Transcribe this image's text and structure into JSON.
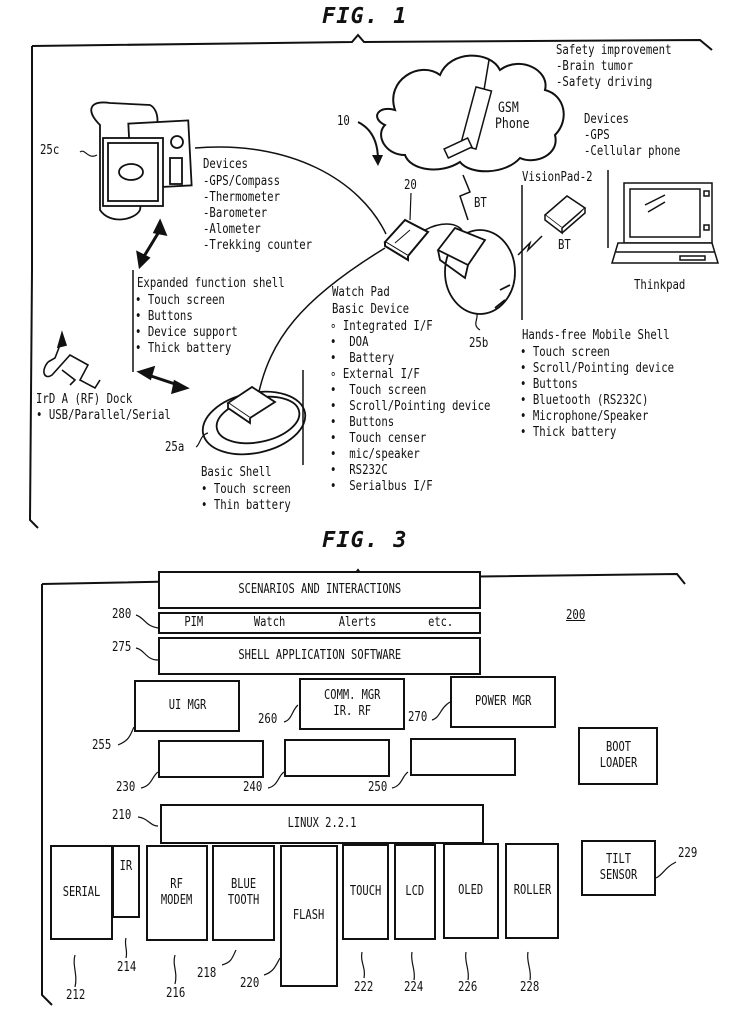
{
  "fig1": {
    "title": "FIG. 1",
    "refs": {
      "r10": "10",
      "r20": "20",
      "r25a": "25a",
      "r25b": "25b",
      "r25c": "25c"
    },
    "cloud": {
      "line1": "GSM",
      "line2": "Phone"
    },
    "safety": {
      "title": "Safety improvement",
      "items": [
        "-Brain tumor",
        "-Safety driving"
      ]
    },
    "devices_right": {
      "title": "Devices",
      "items": [
        "-GPS",
        "-Cellular phone"
      ]
    },
    "visionpad": "VisionPad-2",
    "bt1": "BT",
    "bt2": "BT",
    "thinkpad": "Thinkpad",
    "devices_left": {
      "title": "Devices",
      "items": [
        "-GPS/Compass",
        "-Thermometer",
        "-Barometer",
        "-Alometer",
        "-Trekking counter"
      ]
    },
    "expanded_shell": {
      "title": "Expanded function shell",
      "items": [
        "• Touch screen",
        "• Buttons",
        "• Device support",
        "• Thick battery"
      ]
    },
    "dock": {
      "title": "IrD A (RF) Dock",
      "items": [
        "• USB/Parallel/Serial"
      ]
    },
    "basic_shell": {
      "title": "Basic Shell",
      "items": [
        "• Touch screen",
        "• Thin battery"
      ]
    },
    "watch_pad": {
      "title1": "Watch Pad",
      "title2": "Basic Device",
      "items": [
        "∘ Integrated I/F",
        "•  DOA",
        "•  Battery",
        "∘ External I/F",
        "•  Touch screen",
        "•  Scroll/Pointing device",
        "•  Buttons",
        "•  Touch censer",
        "•  mic/speaker",
        "•  RS232C",
        "•  Serialbus I/F"
      ]
    },
    "handsfree": {
      "title": "Hands-free Mobile Shell",
      "items": [
        "• Touch screen",
        "• Scroll/Pointing device",
        "• Buttons",
        "• Bluetooth (RS232C)",
        "• Microphone/Speaker",
        "• Thick battery"
      ]
    }
  },
  "fig3": {
    "title": "FIG. 3",
    "system_ref": "200",
    "scenarios": "SCENARIOS AND INTERACTIONS",
    "apps": {
      "ref": "280",
      "items": [
        "PIM",
        "Watch",
        "Alerts",
        "etc."
      ]
    },
    "shell_app": {
      "ref": "275",
      "label": "SHELL APPLICATION SOFTWARE"
    },
    "ui_mgr": {
      "ref": "255",
      "label": "UI MGR"
    },
    "comm_mgr": {
      "ref": "260",
      "label": "COMM. MGR\nIR. RF"
    },
    "power_mgr": {
      "ref": "270",
      "label": "POWER MGR"
    },
    "boot_loader": {
      "label": "BOOT\nLOADER"
    },
    "empty_blocks": [
      {
        "ref": "230"
      },
      {
        "ref": "240"
      },
      {
        "ref": "250"
      }
    ],
    "linux": {
      "ref": "210",
      "label": "LINUX 2.2.1"
    },
    "hardware": [
      {
        "ref": "212",
        "label": "SERIAL"
      },
      {
        "ref": "214",
        "label": "IR"
      },
      {
        "ref": "216",
        "label": "RF\nMODEM"
      },
      {
        "ref": "218",
        "label": "BLUE\nTOOTH"
      },
      {
        "ref": "220",
        "label": "FLASH"
      },
      {
        "ref": "222",
        "label": "TOUCH"
      },
      {
        "ref": "224",
        "label": "LCD"
      },
      {
        "ref": "226",
        "label": "OLED"
      },
      {
        "ref": "228",
        "label": "ROLLER"
      }
    ],
    "tilt": {
      "ref": "229",
      "label": "TILT\nSENSOR"
    }
  }
}
